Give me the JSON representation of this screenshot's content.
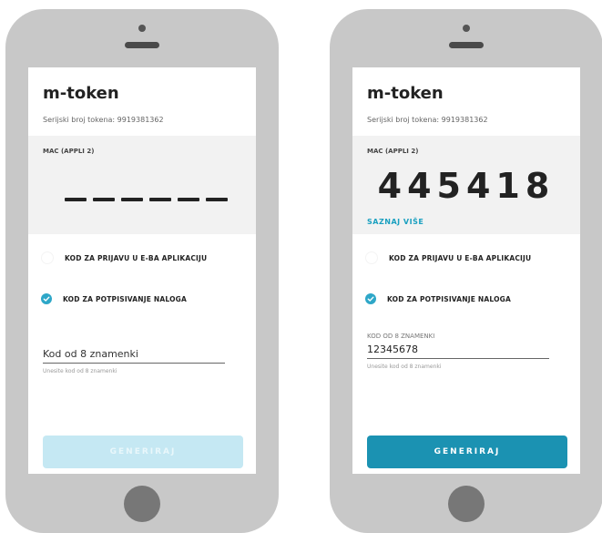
{
  "colors": {
    "phone_body": "#c8c8c8",
    "accent": "#2ea7c8",
    "button_active": "#1b92b2",
    "button_disabled": "#c5e8f3"
  },
  "phones": [
    {
      "title": "m-token",
      "serial": "Serijski broj tokena: 9919381362",
      "mac_label": "MAC (APPLI 2)",
      "options": [
        {
          "label": "KOD ZA PRIJAVU U E-BA APLIKACIJU",
          "selected": false
        },
        {
          "label": "KOD ZA POTPISIVANJE NALOGA",
          "selected": true
        }
      ],
      "input": {
        "caption": "",
        "placeholder": "Kod od 8 znamenki",
        "value": "",
        "hint": "Unesite kod od 8 znamenki"
      },
      "button": {
        "label": "GENERIRAJ",
        "enabled": false
      }
    },
    {
      "title": "m-token",
      "serial": "Serijski broj tokena: 9919381362",
      "mac_label": "MAC (APPLI 2)",
      "mac_code": "445418",
      "learn_more": "SAZNAJ VIŠE",
      "options": [
        {
          "label": "KOD ZA PRIJAVU U E-BA APLIKACIJU",
          "selected": false
        },
        {
          "label": "KOD ZA POTPISIVANJE NALOGA",
          "selected": true
        }
      ],
      "input": {
        "caption": "KOD OD 8 ZNAMENKI",
        "placeholder": "Kod od 8 znamenki",
        "value": "12345678",
        "hint": "Unesite kod od 8 znamenki"
      },
      "button": {
        "label": "GENERIRAJ",
        "enabled": true
      }
    }
  ]
}
